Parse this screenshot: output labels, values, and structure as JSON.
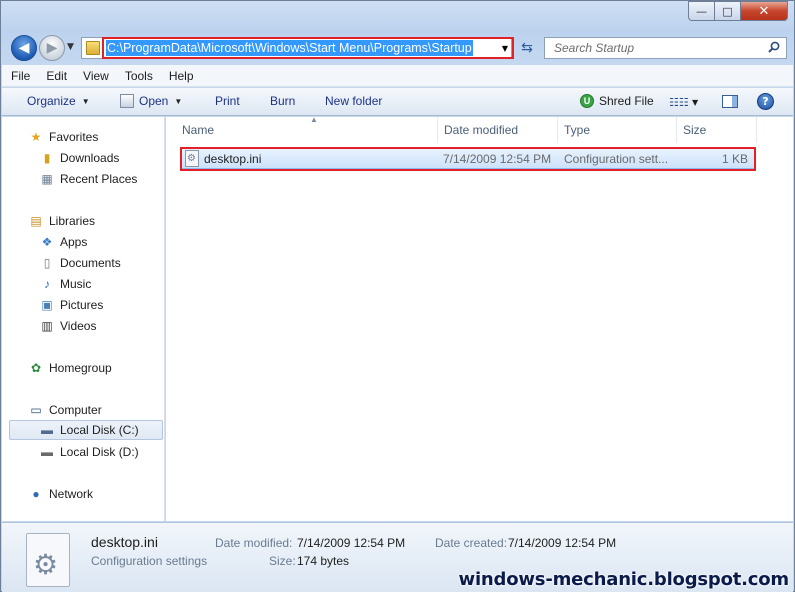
{
  "window": {
    "minimize": "—",
    "maximize": "□",
    "close": "✕"
  },
  "nav": {
    "back_icon": "arrow-left-icon",
    "forward_icon": "arrow-right-icon",
    "address": "C:\\ProgramData\\Microsoft\\Windows\\Start Menu\\Programs\\Startup",
    "search_placeholder": "Search Startup"
  },
  "menu": {
    "items": [
      "File",
      "Edit",
      "View",
      "Tools",
      "Help"
    ]
  },
  "toolbar": {
    "organize": "Organize",
    "open": "Open",
    "print": "Print",
    "burn": "Burn",
    "new_folder": "New folder",
    "shred": "Shred File"
  },
  "sidebar": {
    "favorites": "Favorites",
    "downloads": "Downloads",
    "recent": "Recent Places",
    "libraries": "Libraries",
    "apps": "Apps",
    "documents": "Documents",
    "music": "Music",
    "pictures": "Pictures",
    "videos": "Videos",
    "homegroup": "Homegroup",
    "computer": "Computer",
    "local_c": "Local Disk (C:)",
    "local_d": "Local Disk (D:)",
    "network": "Network"
  },
  "columns": {
    "name": "Name",
    "date": "Date modified",
    "type": "Type",
    "size": "Size"
  },
  "files": [
    {
      "name": "desktop.ini",
      "date": "7/14/2009 12:54 PM",
      "type": "Configuration sett...",
      "size": "1 KB"
    }
  ],
  "details": {
    "name": "desktop.ini",
    "type": "Configuration settings",
    "date_modified_label": "Date modified:",
    "date_modified": "7/14/2009 12:54 PM",
    "size_label": "Size:",
    "size": "174 bytes",
    "date_created_label": "Date created:",
    "date_created": "7/14/2009 12:54 PM"
  },
  "watermark": "windows-mechanic.blogspot.com"
}
